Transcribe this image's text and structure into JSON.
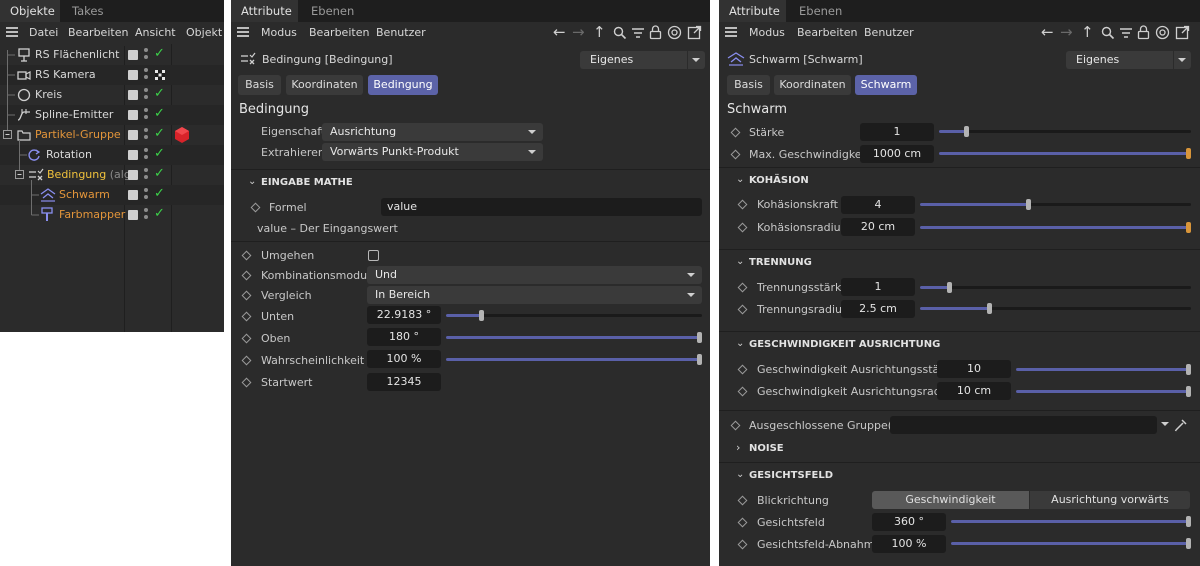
{
  "objects": {
    "tabs": [
      "Objekte",
      "Takes"
    ],
    "menu": [
      "Datei",
      "Bearbeiten",
      "Ansicht",
      "Objekt"
    ],
    "items": [
      {
        "name": "RS Flächenlicht",
        "color": "white",
        "extra": "",
        "icon": "area-light-icon",
        "status": "check"
      },
      {
        "name": "RS Kamera",
        "color": "white",
        "extra": "",
        "icon": "camera-icon",
        "status": "target"
      },
      {
        "name": "Kreis",
        "color": "white",
        "extra": "",
        "icon": "circle-icon",
        "status": "check"
      },
      {
        "name": "Spline-Emitter",
        "color": "white",
        "extra": "",
        "icon": "spline-emitter-icon",
        "status": "check"
      },
      {
        "name": "Partikel-Gruppe",
        "color": "orange",
        "extra": "",
        "icon": "folder-icon",
        "status": "check"
      },
      {
        "name": "Rotation",
        "color": "white",
        "extra": "",
        "icon": "rotation-icon",
        "status": "check"
      },
      {
        "name": "Bedingung",
        "color": "yellow",
        "extra": "(algi",
        "icon": "condition-icon",
        "status": "check"
      },
      {
        "name": "Schwarm",
        "color": "orange",
        "extra": "",
        "icon": "flock-icon",
        "status": "check"
      },
      {
        "name": "Farbmapper",
        "color": "orange",
        "extra": "",
        "icon": "color-mapper-icon",
        "status": "check"
      }
    ]
  },
  "attr1": {
    "tabs": [
      "Attribute",
      "Ebenen"
    ],
    "menu": [
      "Modus",
      "Bearbeiten",
      "Benutzer"
    ],
    "object_title": "Bedingung [Bedingung]",
    "preset": "Eigenes",
    "tab_buttons": [
      "Basis",
      "Koordinaten",
      "Bedingung"
    ],
    "section_title": "Bedingung",
    "eigenschaft_label": "Eigenschaft",
    "eigenschaft_value": "Ausrichtung",
    "extrahieren_label": "Extrahieren",
    "extrahieren_value": "Vorwärts Punkt-Produkt",
    "eingabe_header": "EINGABE MATHE",
    "formel_label": "Formel",
    "formel_value": "value",
    "formel_hint": "value – Der Eingangswert",
    "umgehen_label": "Umgehen",
    "kombination_label": "Kombinationsmodus",
    "kombination_value": "Und",
    "vergleich_label": "Vergleich",
    "vergleich_value": "In Bereich",
    "unten_label": "Unten",
    "unten_value": "22.9183 °",
    "unten_fraction": 0.13,
    "oben_label": "Oben",
    "oben_value": "180 °",
    "oben_fraction": 1.0,
    "wahrsch_label": "Wahrscheinlichkeit",
    "wahrsch_value": "100 %",
    "wahrsch_fraction": 1.0,
    "startwert_label": "Startwert",
    "startwert_value": "12345"
  },
  "attr2": {
    "tabs": [
      "Attribute",
      "Ebenen"
    ],
    "menu": [
      "Modus",
      "Bearbeiten",
      "Benutzer"
    ],
    "object_title": "Schwarm [Schwarm]",
    "preset": "Eigenes",
    "tab_buttons": [
      "Basis",
      "Koordinaten",
      "Schwarm"
    ],
    "section_title": "Schwarm",
    "staerke_label": "Stärke",
    "staerke_value": "1",
    "staerke_fraction": 0.1,
    "maxgeschw_label": "Max. Geschwindigkeit",
    "maxgeschw_value": "1000 cm",
    "maxgeschw_fraction": 1.0,
    "kohaesion_header": "KOHÄSION",
    "kkraft_label": "Kohäsionskraft",
    "kkraft_value": "4",
    "kkraft_fraction": 0.4,
    "kradius_label": "Kohäsionsradius",
    "kradius_value": "20 cm",
    "kradius_fraction": 1.0,
    "trennung_header": "TRENNUNG",
    "tstaerke_label": "Trennungsstärke",
    "tstaerke_value": "1",
    "tstaerke_fraction": 0.1,
    "tradius_label": "Trennungsradius",
    "tradius_value": "2.5 cm",
    "tradius_fraction": 0.25,
    "ausrichtung_header": "GESCHWINDIGKEIT AUSRICHTUNG",
    "gastaerke_label": "Geschwindigkeit Ausrichtungsstärke",
    "gastaerke_value": "10",
    "gastaerke_fraction": 1.0,
    "garadius_label": "Geschwindigkeit Ausrichtungsradius",
    "garadius_value": "10 cm",
    "garadius_fraction": 1.0,
    "ausgeschl_label": "Ausgeschlossene Gruppe(n)",
    "noise_header": "NOISE",
    "gesichtsfeld_header": "GESICHTSFELD",
    "blick_label": "Blickrichtung",
    "blick_options": [
      "Geschwindigkeit",
      "Ausrichtung vorwärts"
    ],
    "gf_label": "Gesichtsfeld",
    "gf_value": "360 °",
    "gf_fraction": 1.0,
    "gfa_label": "Gesichtsfeld-Abnahme",
    "gfa_value": "100 %",
    "gfa_fraction": 1.0
  },
  "colors": {
    "accent": "#5c63a8",
    "check": "#3cd14a",
    "orange_text": "#e3953a",
    "yellow_text": "#f0c23c"
  }
}
